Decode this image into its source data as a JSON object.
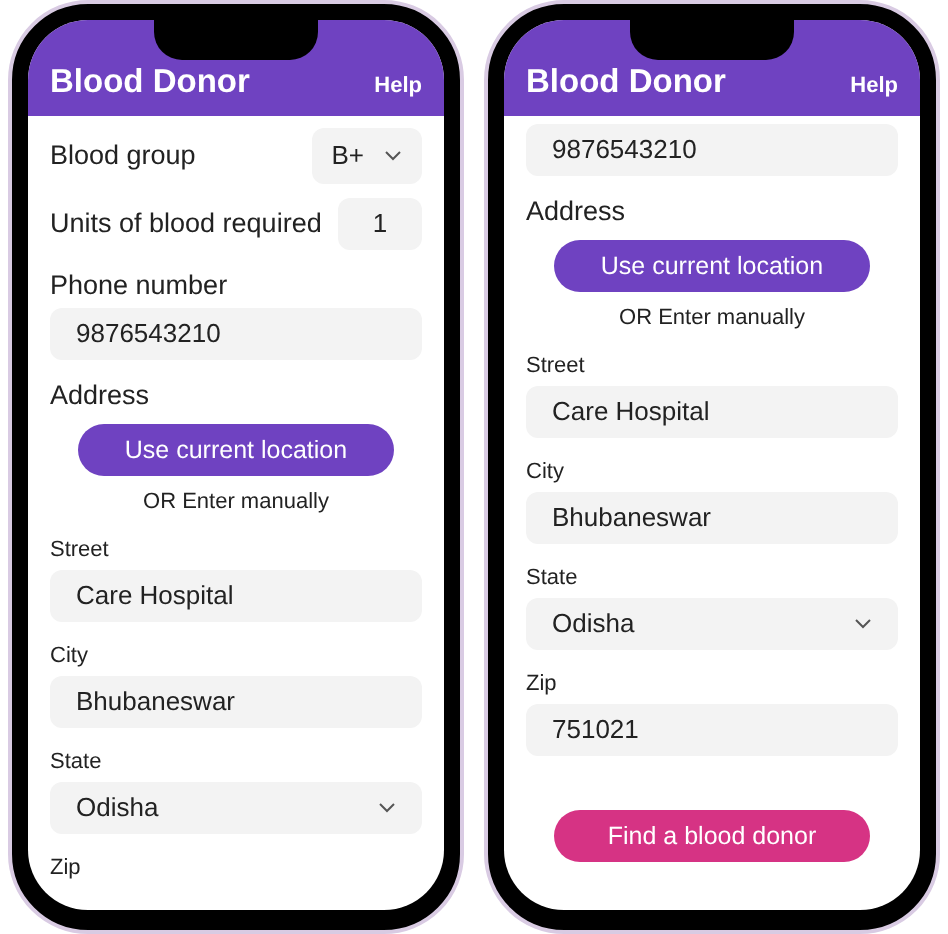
{
  "phones": [
    {
      "header": {
        "title": "Blood Donor",
        "help": "Help"
      },
      "items": [
        {
          "kind": "select_row",
          "label": "Blood group",
          "value": "B+"
        },
        {
          "kind": "input_row",
          "label": "Units of blood required",
          "value": "1"
        },
        {
          "kind": "section_label",
          "text": "Phone number"
        },
        {
          "kind": "field",
          "value": "9876543210"
        },
        {
          "kind": "section_label",
          "text": "Address"
        },
        {
          "kind": "button",
          "text": "Use current location",
          "color": "#6f42c1"
        },
        {
          "kind": "note",
          "text": "OR Enter manually"
        },
        {
          "kind": "field_label",
          "text": "Street"
        },
        {
          "kind": "field",
          "value": "Care Hospital"
        },
        {
          "kind": "field_label",
          "text": "City"
        },
        {
          "kind": "field",
          "value": "Bhubaneswar"
        },
        {
          "kind": "field_label",
          "text": "State"
        },
        {
          "kind": "select",
          "value": "Odisha"
        },
        {
          "kind": "field_label",
          "text": "Zip"
        }
      ]
    },
    {
      "header": {
        "title": "Blood Donor",
        "help": "Help"
      },
      "items": [
        {
          "kind": "field",
          "value": "9876543210"
        },
        {
          "kind": "section_label",
          "text": "Address"
        },
        {
          "kind": "button",
          "text": "Use current location",
          "color": "#6f42c1"
        },
        {
          "kind": "note",
          "text": "OR Enter manually"
        },
        {
          "kind": "field_label",
          "text": "Street"
        },
        {
          "kind": "field",
          "value": "Care Hospital"
        },
        {
          "kind": "field_label",
          "text": "City"
        },
        {
          "kind": "field",
          "value": "Bhubaneswar"
        },
        {
          "kind": "field_label",
          "text": "State"
        },
        {
          "kind": "select",
          "value": "Odisha"
        },
        {
          "kind": "field_label",
          "text": "Zip"
        },
        {
          "kind": "field",
          "value": "751021"
        },
        {
          "kind": "button",
          "text": "Find a blood donor",
          "color": "#d63384"
        }
      ]
    }
  ]
}
